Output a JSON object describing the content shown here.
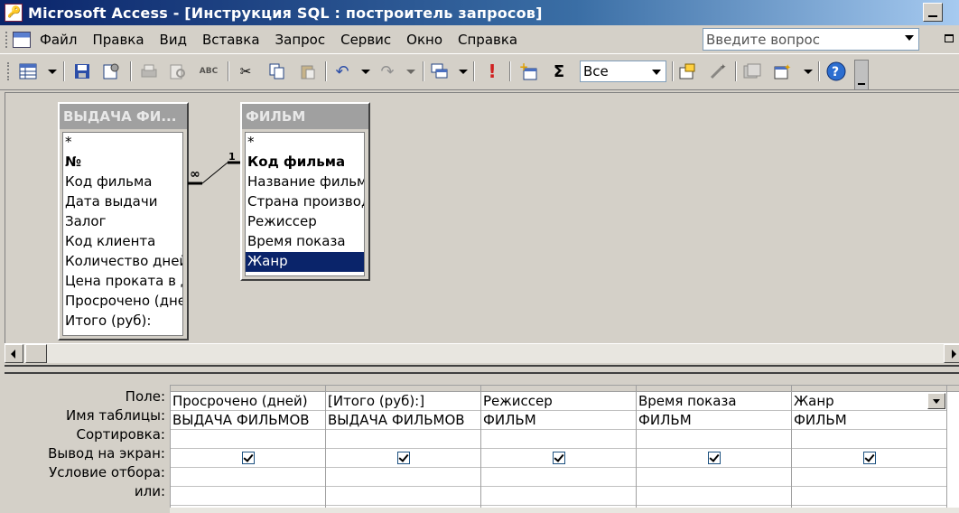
{
  "window": {
    "title": "Microsoft Access - [Инструкция SQL : построитель запросов]"
  },
  "menu": {
    "items": [
      "Файл",
      "Правка",
      "Вид",
      "Вставка",
      "Запрос",
      "Сервис",
      "Окно",
      "Справка"
    ],
    "ask_placeholder": "Введите вопрос"
  },
  "toolbar": {
    "top_values": "Все",
    "sigma": "Σ",
    "run": "!"
  },
  "tables": [
    {
      "name": "ВЫДАЧА ФИ...",
      "fields": [
        "*",
        "№",
        "Код фильма",
        "Дата выдачи",
        "Залог",
        "Код клиента",
        "Количество дней",
        "Цена проката в день",
        "Просрочено (дней)",
        "Итого (руб):"
      ],
      "key_field": "№"
    },
    {
      "name": "ФИЛЬМ",
      "fields": [
        "*",
        "Код фильма",
        "Название фильма",
        "Страна производитель",
        "Режиссер",
        "Время показа",
        "Жанр"
      ],
      "key_field": "Код фильма",
      "selected_field": "Жанр"
    }
  ],
  "join": {
    "many": "∞",
    "one": "1"
  },
  "grid": {
    "row_labels": [
      "Поле:",
      "Имя таблицы:",
      "Сортировка:",
      "Вывод на экран:",
      "Условие отбора:",
      "или:"
    ],
    "columns": [
      {
        "field": "Просрочено (дней)",
        "table": "ВЫДАЧА ФИЛЬМОВ",
        "sort": "",
        "show": true,
        "criteria": "",
        "or": ""
      },
      {
        "field": "[Итого (руб):]",
        "table": "ВЫДАЧА ФИЛЬМОВ",
        "sort": "",
        "show": true,
        "criteria": "",
        "or": ""
      },
      {
        "field": "Режиссер",
        "table": "ФИЛЬМ",
        "sort": "",
        "show": true,
        "criteria": "",
        "or": ""
      },
      {
        "field": "Время показа",
        "table": "ФИЛЬМ",
        "sort": "",
        "show": true,
        "criteria": "",
        "or": ""
      },
      {
        "field": "Жанр",
        "table": "ФИЛЬМ",
        "sort": "",
        "show": true,
        "criteria": "",
        "or": ""
      }
    ]
  }
}
